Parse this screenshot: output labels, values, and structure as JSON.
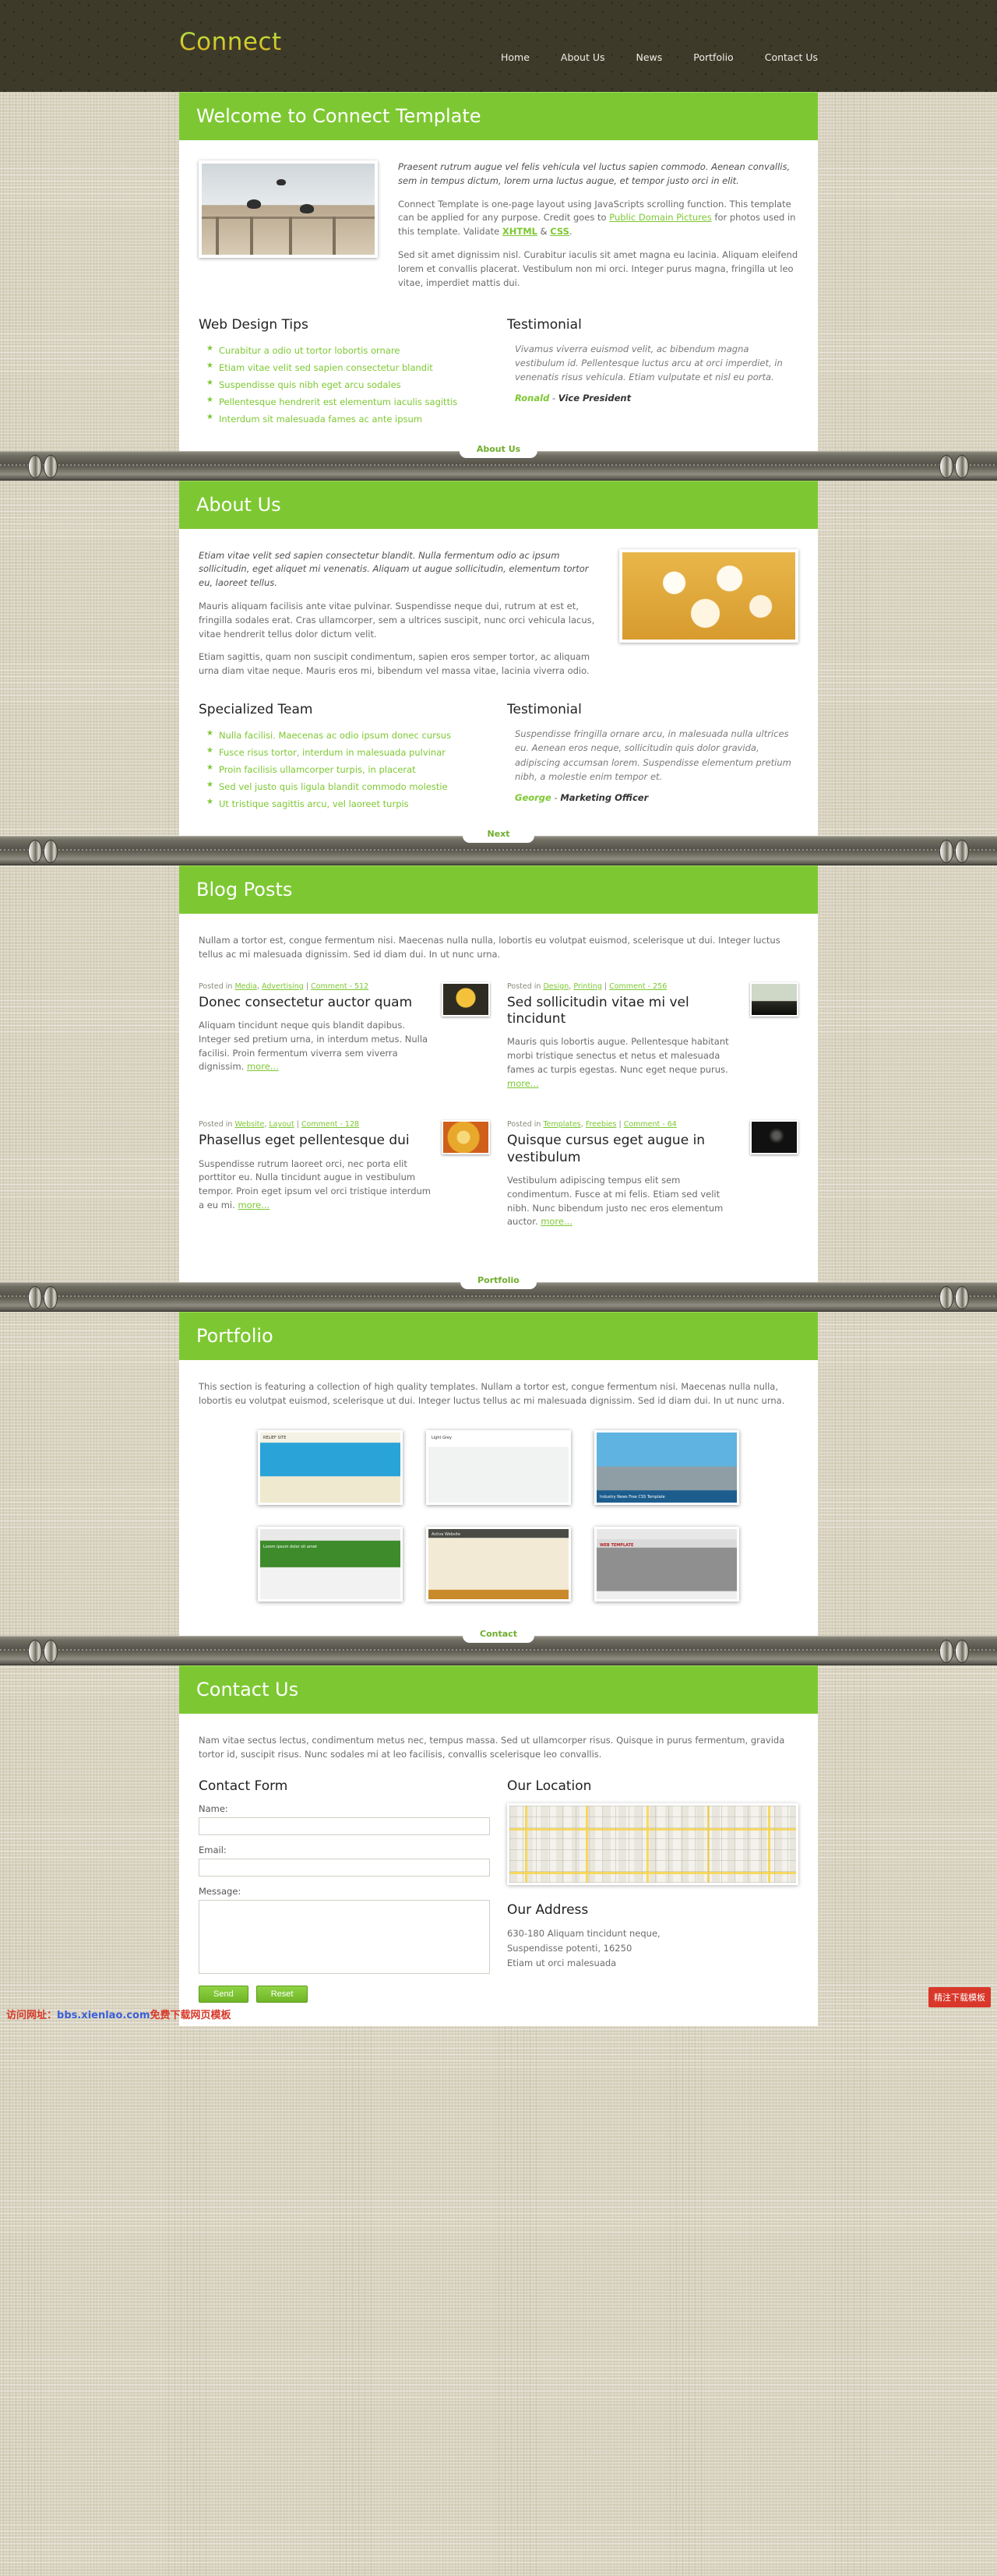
{
  "header": {
    "logo": "Connect",
    "nav": [
      {
        "label": "Home"
      },
      {
        "label": "About Us"
      },
      {
        "label": "News"
      },
      {
        "label": "Portfolio"
      },
      {
        "label": "Contact Us"
      }
    ]
  },
  "welcome": {
    "title": "Welcome to Connect Template",
    "lead": "Praesent rutrum augue vel felis vehicula vel luctus sapien commodo. Aenean convallis, sem in tempus dictum, lorem urna luctus augue, et tempor justo orci in elit.",
    "para2_a": "Connect Template is one-page layout using JavaScripts scrolling function. This template can be applied for any purpose. Credit goes to ",
    "link_pdp": "Public Domain Pictures",
    "para2_b": " for photos used in this template. Validate ",
    "link_xhtml": "XHTML",
    "amp": " & ",
    "link_css": "CSS",
    "para2_c": ".",
    "para3": "Sed sit amet dignissim nisl. Curabitur iaculis sit amet magna eu lacinia. Aliquam eleifend lorem et convallis placerat. Vestibulum non mi orci. Integer purus magna, fringilla ut leo vitae, imperdiet mattis dui.",
    "tips_title": "Web Design Tips",
    "tips": [
      "Curabitur a odio ut tortor lobortis ornare",
      "Etiam vitae velit sed sapien consectetur blandit",
      "Suspendisse quis nibh eget arcu sodales",
      "Pellentesque hendrerit est elementum iaculis sagittis",
      "Interdum sit malesuada fames ac ante ipsum"
    ],
    "testimonial_title": "Testimonial",
    "testimonial_quote": "Vivamus viverra euismod velit, ac bibendum magna vestibulum id. Pellentesque luctus arcu at orci imperdiet, in venenatis risus vehicula. Etiam vulputate et nisl eu porta.",
    "testimonial_who": "Ronald",
    "testimonial_dash": " - ",
    "testimonial_role": "Vice President"
  },
  "rails": [
    {
      "tab": "About Us"
    },
    {
      "tab": "Next"
    },
    {
      "tab": "Portfolio"
    },
    {
      "tab": "Contact"
    }
  ],
  "about": {
    "title": "About Us",
    "lead": "Etiam vitae velit sed sapien consectetur blandit. Nulla fermentum odio ac ipsum sollicitudin, eget aliquet mi venenatis. Aliquam ut augue sollicitudin, elementum tortor eu, laoreet tellus.",
    "para2": "Mauris aliquam facilisis ante vitae pulvinar. Suspendisse neque dui, rutrum at est et, fringilla sodales erat. Cras ullamcorper, sem a ultrices suscipit, nunc orci vehicula lacus, vitae hendrerit tellus dolor dictum velit.",
    "para3": "Etiam sagittis, quam non suscipit condimentum, sapien eros semper tortor, ac aliquam urna diam vitae neque. Mauris eros mi, bibendum vel massa vitae, lacinia viverra odio.",
    "team_title": "Specialized Team",
    "team": [
      "Nulla facilisi. Maecenas ac odio ipsum donec cursus",
      "Fusce risus tortor, interdum in malesuada pulvinar",
      "Proin facilisis ullamcorper turpis, in placerat",
      "Sed vel justo quis ligula blandit commodo molestie",
      "Ut tristique sagittis arcu, vel laoreet turpis"
    ],
    "testimonial_title": "Testimonial",
    "testimonial_quote": "Suspendisse fringilla ornare arcu, in malesuada nulla ultrices eu. Aenean eros neque, sollicitudin quis dolor gravida, adipiscing accumsan lorem. Suspendisse elementum pretium nibh, a molestie enim tempor et.",
    "testimonial_who": "George",
    "testimonial_dash": " - ",
    "testimonial_role": "Marketing Officer"
  },
  "blog": {
    "title": "Blog Posts",
    "intro": "Nullam a tortor est, congue fermentum nisi. Maecenas nulla nulla, lobortis eu volutpat euismod, scelerisque ut dui. Integer luctus tellus ac mi malesuada dignissim. Sed id diam dui. In ut nunc urna.",
    "more_label": "more...",
    "posted_in": "Posted in ",
    "posts": [
      {
        "cat1": "Media",
        "cat2": "Advertising",
        "comment": "Comment - 512",
        "title": "Donec consectetur auctor quam",
        "body": "Aliquam tincidunt neque quis blandit dapibus. Integer sed pretium urna, in interdum metus. Nulla facilisi. Proin fermentum viverra sem viverra dignissim. "
      },
      {
        "cat1": "Design",
        "cat2": "Printing",
        "comment": "Comment - 256",
        "title": "Sed sollicitudin vitae mi vel tincidunt",
        "body": "Mauris quis lobortis augue. Pellentesque habitant morbi tristique senectus et netus et malesuada fames ac turpis egestas. Nunc eget neque purus. "
      },
      {
        "cat1": "Website",
        "cat2": "Layout",
        "comment": "Comment - 128",
        "title": "Phasellus eget pellentesque dui",
        "body": "Suspendisse rutrum laoreet orci, nec porta elit porttitor eu. Nulla tincidunt augue in vestibulum tempor. Proin eget ipsum vel orci tristique interdum a eu mi. "
      },
      {
        "cat1": "Templates",
        "cat2": "Freebies",
        "comment": "Comment - 64",
        "title": "Quisque cursus eget augue in vestibulum",
        "body": "Vestibulum adipiscing tempus elit sem condimentum. Fusce at mi felis. Etiam sed velit nibh. Nunc bibendum justo nec eros elementum auctor. "
      }
    ]
  },
  "portfolio": {
    "title": "Portfolio",
    "intro": "This section is featuring a collection of high quality templates. Nullam a tortor est, congue fermentum nisi. Maecenas nulla nulla, lobortis eu volutpat euismod, scelerisque ut dui. Integer luctus tellus ac mi malesuada dignissim. Sed id diam dui. In ut nunc urna.",
    "items": [
      {
        "caption": "RELIEF SITE"
      },
      {
        "caption": "Light Grey"
      },
      {
        "caption": "Industry News   Free CSS Template"
      },
      {
        "caption": "Lorem ipsum dolor sit amet"
      },
      {
        "caption": "Active Website"
      },
      {
        "caption": "WEB TEMPLATE"
      }
    ]
  },
  "contact": {
    "title": "Contact Us",
    "intro": "Nam vitae sectus lectus, condimentum metus nec, tempus massa. Sed ut ullamcorper risus. Quisque in purus fermentum, gravida tortor id, suscipit risus. Nunc sodales mi at leo facilisis, convallis scelerisque leo convallis.",
    "form_title": "Contact Form",
    "name_label": "Name:",
    "email_label": "Email:",
    "message_label": "Message:",
    "send_label": "Send",
    "reset_label": "Reset",
    "location_title": "Our Location",
    "address_title": "Our Address",
    "address_line1": "630-180 Aliquam tincidunt neque,",
    "address_line2": "Suspendisse potenti, 16250",
    "address_line3": "Etiam ut orci malesuada"
  },
  "overlays": {
    "watermark_red1": "访问网址：",
    "watermark_blue": "bbs.xienlao.com",
    "watermark_red2": "免费下载网页模板",
    "download_button": "精注下载模板"
  },
  "colors": {
    "accent_green": "#7dc832",
    "header_dark": "#3d3a2a",
    "page_bg": "#d8d2bf"
  }
}
